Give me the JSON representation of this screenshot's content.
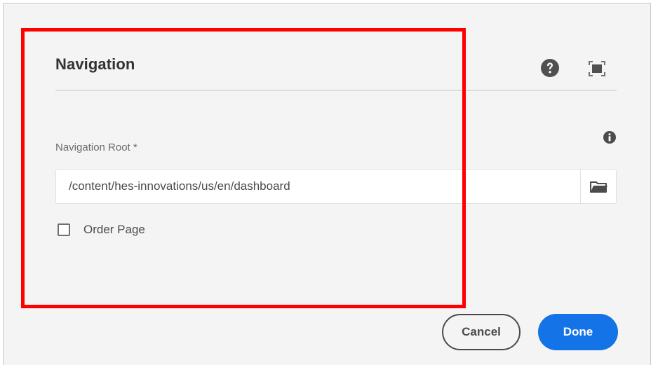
{
  "dialog": {
    "title": "Navigation",
    "help_icon": "help-circle-icon",
    "fullscreen_icon": "fullscreen-icon"
  },
  "form": {
    "info_icon": "info-icon",
    "navigation_root": {
      "label": "Navigation Root *",
      "value": "/content/hes-innovations/us/en/dashboard",
      "browse_icon": "folder-icon"
    },
    "order_page": {
      "label": "Order Page",
      "checked": false
    }
  },
  "footer": {
    "cancel_label": "Cancel",
    "done_label": "Done"
  },
  "colors": {
    "accent": "#1473e6",
    "highlight": "#ff0000",
    "background": "#f4f4f4"
  }
}
